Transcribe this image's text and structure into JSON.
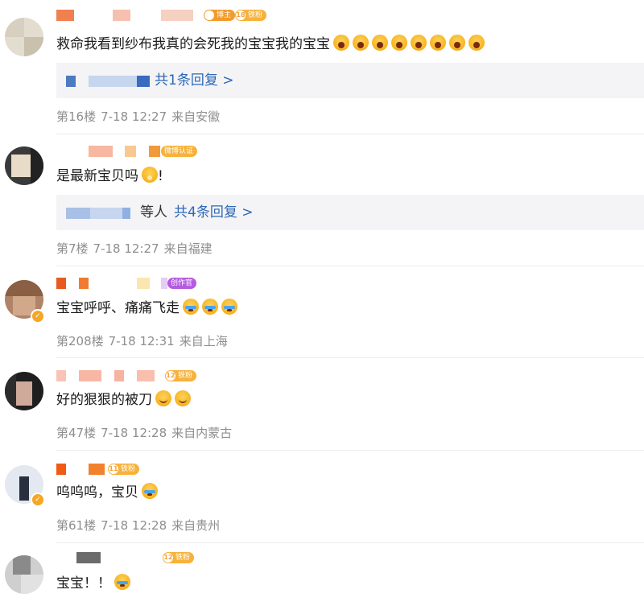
{
  "comments": [
    {
      "badges": [
        {
          "level": "",
          "text": "博主",
          "color": "#f39a2a"
        },
        {
          "level": "18",
          "text": "铁粉",
          "color": "#f7b23b"
        }
      ],
      "text": "救命我看到纱布我真的会死我的宝宝我的宝宝",
      "emojis": [
        "scream",
        "scream",
        "scream",
        "scream",
        "scream",
        "scream",
        "scream",
        "scream"
      ],
      "replies": {
        "etc": "",
        "label": "共1条回复 >"
      },
      "floor": "第16楼",
      "time": "7-18 12:27",
      "location": "来自安徽"
    },
    {
      "badges": [
        {
          "level": "",
          "text": "微博认证",
          "color": "#f7b23b"
        }
      ],
      "text": "是最新宝贝吗",
      "emojis": [
        "pray"
      ],
      "text_suffix": "!",
      "replies": {
        "etc": "等人",
        "label": "共4条回复 >"
      },
      "floor": "第7楼",
      "time": "7-18 12:27",
      "location": "来自福建"
    },
    {
      "badges": [
        {
          "level": "",
          "text": "创作官",
          "color": "#b55be0"
        }
      ],
      "text": "宝宝呼呼、痛痛飞走",
      "emojis": [
        "cry",
        "cry",
        "cry"
      ],
      "floor": "第208楼",
      "time": "7-18 12:31",
      "location": "来自上海"
    },
    {
      "badges": [
        {
          "level": "12",
          "text": "铁粉",
          "color": "#f7b23b"
        }
      ],
      "text": "好的狠狠的被刀",
      "emojis": [
        "smile",
        "smile"
      ],
      "floor": "第47楼",
      "time": "7-18 12:28",
      "location": "来自内蒙古"
    },
    {
      "badges": [
        {
          "level": "11",
          "text": "铁粉",
          "color": "#f7b23b"
        }
      ],
      "text": "呜呜呜，宝贝",
      "emojis": [
        "cry"
      ],
      "floor": "第61楼",
      "time": "7-18 12:28",
      "location": "来自贵州"
    },
    {
      "badges": [
        {
          "level": "12",
          "text": "铁粉",
          "color": "#f7b23b"
        }
      ],
      "text": "宝宝！！",
      "emojis": [
        "cry"
      ]
    }
  ]
}
